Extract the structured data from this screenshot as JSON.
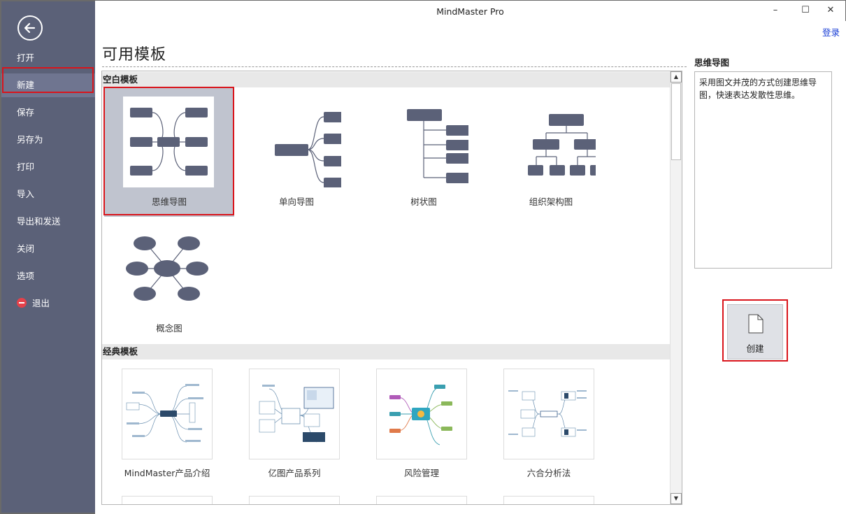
{
  "window": {
    "title": "MindMaster Pro",
    "controls": [
      "–",
      "☐",
      "✕"
    ],
    "login": "登录"
  },
  "sidebar": {
    "items": [
      {
        "label": "打开"
      },
      {
        "label": "新建"
      },
      {
        "label": "保存"
      },
      {
        "label": "另存为"
      },
      {
        "label": "打印"
      },
      {
        "label": "导入"
      },
      {
        "label": "导出和发送"
      },
      {
        "label": "关闭"
      },
      {
        "label": "选项"
      },
      {
        "label": "退出"
      }
    ]
  },
  "main": {
    "title": "可用模板",
    "sections": [
      {
        "header": "空白模板",
        "templates": [
          {
            "label": "思维导图",
            "icon": "mindmap-icon"
          },
          {
            "label": "单向导图",
            "icon": "right-map-icon"
          },
          {
            "label": "树状图",
            "icon": "tree-chart-icon"
          },
          {
            "label": "组织架构图",
            "icon": "org-chart-icon"
          },
          {
            "label": "概念图",
            "icon": "concept-map-icon"
          }
        ]
      },
      {
        "header": "经典模板",
        "templates": [
          {
            "label": "MindMaster产品介绍"
          },
          {
            "label": "亿图产品系列"
          },
          {
            "label": "风险管理"
          },
          {
            "label": "六合分析法"
          }
        ]
      }
    ]
  },
  "details": {
    "title": "思维导图",
    "description": "采用图文并茂的方式创建思维导图，快速表达发散性思维。",
    "create_label": "创建"
  },
  "colors": {
    "sidebar": "#5b6178",
    "node": "#5b6178",
    "highlight": "#d9141b",
    "link": "#1a3fd6"
  }
}
